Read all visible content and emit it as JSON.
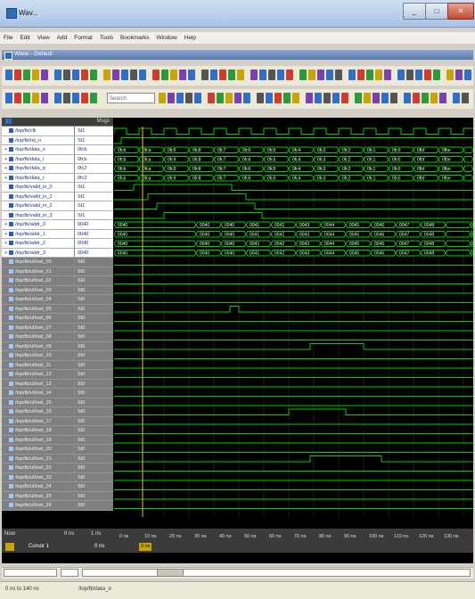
{
  "window": {
    "title": "Wav..."
  },
  "menu": [
    "File",
    "Edit",
    "View",
    "Add",
    "Format",
    "Tools",
    "Bookmarks",
    "Window",
    "Help"
  ],
  "inner_title": "Wave - Default",
  "toolbar": {
    "search_placeholder": "Search"
  },
  "wave": {
    "header_label": "Msgs",
    "signals": [
      {
        "name": "/top/tb/clk",
        "value": "St1",
        "kind": "bit",
        "style": "w"
      },
      {
        "name": "/top/tb/rst_n",
        "value": "St1",
        "kind": "bit",
        "style": "w"
      },
      {
        "name": "/top/tb/data_o",
        "value": "0fcb",
        "kind": "bus",
        "style": "w"
      },
      {
        "name": "/top/tb/data_i",
        "value": "0fcb",
        "kind": "bus",
        "style": "w"
      },
      {
        "name": "/top/tb/data_q",
        "value": "0fc2",
        "kind": "bus",
        "style": "w"
      },
      {
        "name": "/top/tb/data_r",
        "value": "0fc2",
        "kind": "bus",
        "style": "w"
      },
      {
        "name": "/top/tb/valid_in_0",
        "value": "St1",
        "kind": "bit",
        "style": "w"
      },
      {
        "name": "/top/tb/valid_in_1",
        "value": "St1",
        "kind": "bit",
        "style": "w"
      },
      {
        "name": "/top/tb/valid_in_2",
        "value": "St1",
        "kind": "bit",
        "style": "w"
      },
      {
        "name": "/top/tb/valid_in_3",
        "value": "St1",
        "kind": "bit",
        "style": "w"
      },
      {
        "name": "/top/tb/addr_0",
        "value": "0040",
        "kind": "bus",
        "style": "w"
      },
      {
        "name": "/top/tb/addr_1",
        "value": "0040",
        "kind": "bus",
        "style": "w"
      },
      {
        "name": "/top/tb/addr_2",
        "value": "0040",
        "kind": "bus",
        "style": "w"
      },
      {
        "name": "/top/tb/addr_3",
        "value": "0040",
        "kind": "bus",
        "style": "w"
      },
      {
        "name": "/top/tb/u0/sel_00",
        "value": "St0",
        "kind": "bit",
        "style": "g"
      },
      {
        "name": "/top/tb/u0/sel_01",
        "value": "St0",
        "kind": "bit",
        "style": "g"
      },
      {
        "name": "/top/tb/u0/sel_02",
        "value": "St0",
        "kind": "bit",
        "style": "g"
      },
      {
        "name": "/top/tb/u0/sel_03",
        "value": "St0",
        "kind": "bit",
        "style": "g"
      },
      {
        "name": "/top/tb/u0/sel_04",
        "value": "St0",
        "kind": "bit",
        "style": "g"
      },
      {
        "name": "/top/tb/u0/sel_05",
        "value": "St0",
        "kind": "bit",
        "style": "g"
      },
      {
        "name": "/top/tb/u0/sel_06",
        "value": "St0",
        "kind": "bit",
        "style": "g"
      },
      {
        "name": "/top/tb/u0/sel_07",
        "value": "St0",
        "kind": "bit",
        "style": "g"
      },
      {
        "name": "/top/tb/u0/sel_08",
        "value": "St0",
        "kind": "bit",
        "style": "g"
      },
      {
        "name": "/top/tb/u0/sel_09",
        "value": "St0",
        "kind": "bit",
        "style": "g"
      },
      {
        "name": "/top/tb/u0/sel_10",
        "value": "St0",
        "kind": "bit",
        "style": "g"
      },
      {
        "name": "/top/tb/u0/sel_11",
        "value": "St0",
        "kind": "bit",
        "style": "g"
      },
      {
        "name": "/top/tb/u0/sel_12",
        "value": "St0",
        "kind": "bit",
        "style": "g"
      },
      {
        "name": "/top/tb/u0/sel_13",
        "value": "St0",
        "kind": "bit",
        "style": "g"
      },
      {
        "name": "/top/tb/u0/sel_14",
        "value": "St0",
        "kind": "bit",
        "style": "g"
      },
      {
        "name": "/top/tb/u0/sel_15",
        "value": "St0",
        "kind": "bit",
        "style": "g"
      },
      {
        "name": "/top/tb/u0/sel_16",
        "value": "St0",
        "kind": "bit",
        "style": "g"
      },
      {
        "name": "/top/tb/u0/sel_17",
        "value": "St0",
        "kind": "bit",
        "style": "g"
      },
      {
        "name": "/top/tb/u0/sel_18",
        "value": "St0",
        "kind": "bit",
        "style": "g"
      },
      {
        "name": "/top/tb/u0/sel_19",
        "value": "St0",
        "kind": "bit",
        "style": "g"
      },
      {
        "name": "/top/tb/u0/sel_20",
        "value": "St0",
        "kind": "bit",
        "style": "g"
      },
      {
        "name": "/top/tb/u0/sel_21",
        "value": "St0",
        "kind": "bit",
        "style": "g"
      },
      {
        "name": "/top/tb/u0/sel_22",
        "value": "St0",
        "kind": "bit",
        "style": "g"
      },
      {
        "name": "/top/tb/u0/sel_23",
        "value": "St0",
        "kind": "bit",
        "style": "g"
      },
      {
        "name": "/top/tb/u0/sel_24",
        "value": "St0",
        "kind": "bit",
        "style": "g"
      },
      {
        "name": "/top/tb/u0/sel_25",
        "value": "St0",
        "kind": "bit",
        "style": "g"
      },
      {
        "name": "/top/tb/u0/sel_26",
        "value": "St0",
        "kind": "bit",
        "style": "g"
      }
    ],
    "bus_labels": [
      "0fcb",
      "0fca",
      "0fc9",
      "0fc8",
      "0fc7",
      "0fc6",
      "0fc5",
      "0fc4",
      "0fc3",
      "0fc2",
      "0fc1",
      "0fc0",
      "0fbf",
      "0fbe"
    ],
    "addr_labels": [
      "0040",
      "0040",
      "0040",
      "0041",
      "0042",
      "0043",
      "0044",
      "0045",
      "0046",
      "0047",
      "0048"
    ],
    "time_ticks": [
      "0 ns",
      "10 ns",
      "20 ns",
      "30 ns",
      "40 ns",
      "50 ns",
      "60 ns",
      "70 ns",
      "80 ns",
      "90 ns",
      "100 ns",
      "110 ns",
      "120 ns",
      "130 ns"
    ],
    "bottom": {
      "now_label": "Now",
      "now_value": "0 ns",
      "scale": "1 ns"
    },
    "cursor": {
      "label": "Cursor 1",
      "value": "0 ns",
      "tag": "0 ns"
    },
    "colors": {
      "wave": "#00d000",
      "cursor": "#e0a000",
      "grid": "#1f3a1f"
    }
  },
  "status": {
    "left": "0 ns to 140 ns",
    "signal": "/top/tb/data_o"
  }
}
